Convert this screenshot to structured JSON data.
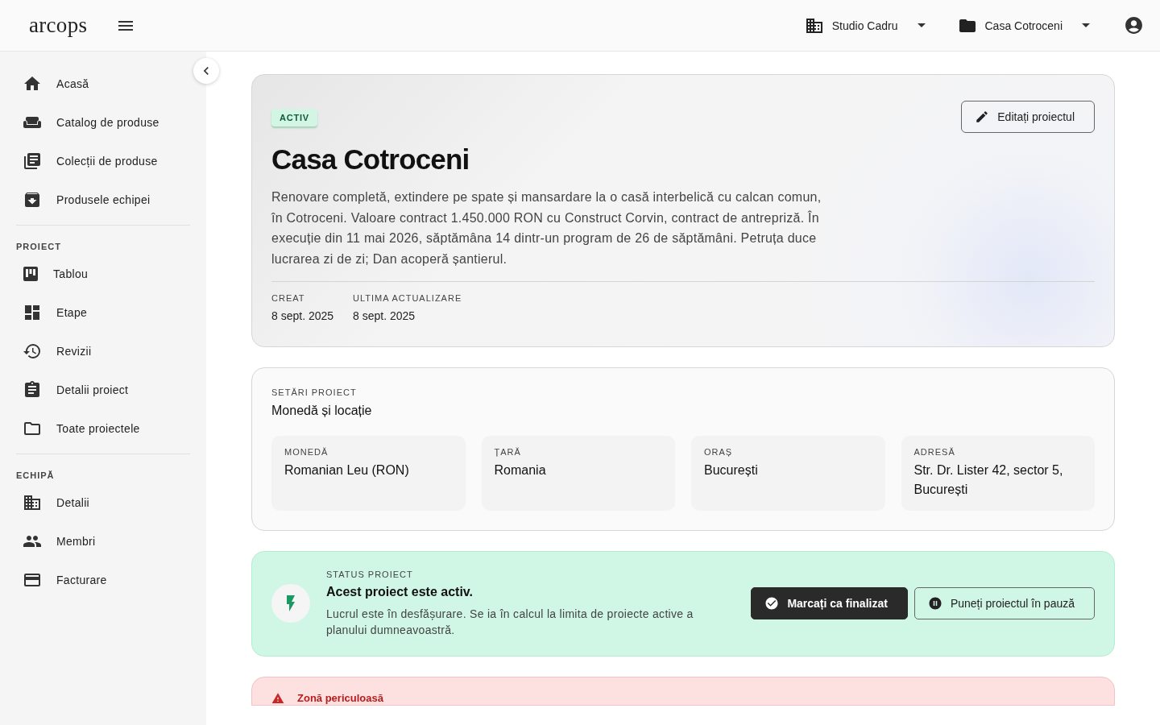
{
  "header": {
    "logo": "arcops",
    "workspace": "Studio Cadru",
    "project": "Casa Cotroceni"
  },
  "sidebar": {
    "sections": [
      {
        "items": [
          {
            "label": "Acasă"
          },
          {
            "label": "Catalog de produse"
          },
          {
            "label": "Colecții de produse"
          },
          {
            "label": "Produsele echipei"
          }
        ]
      },
      {
        "heading": "PROIECT",
        "items": [
          {
            "label": "Tablou"
          },
          {
            "label": "Etape"
          },
          {
            "label": "Revizii"
          },
          {
            "label": "Detalii proiect"
          },
          {
            "label": "Toate proiectele"
          }
        ]
      },
      {
        "heading": "ECHIPĂ",
        "items": [
          {
            "label": "Detalii"
          },
          {
            "label": "Membri"
          },
          {
            "label": "Facturare"
          }
        ]
      }
    ]
  },
  "overview": {
    "badge": "ACTIV",
    "edit_button": "Editați proiectul",
    "title": "Casa Cotroceni",
    "description": "Renovare completă, extindere pe spate și mansardare la o casă interbelică cu calcan comun, în Cotroceni. Valoare contract 1.450.000 RON cu Construct Corvin, contract de antrepriză. În execuție din 11 mai 2026, săptămâna 14 dintr-un program de 26 de săptămâni. Petruța duce lucrarea zi de zi; Dan acoperă șantierul.",
    "meta": [
      {
        "label": "CREAT",
        "value": "8 sept. 2025"
      },
      {
        "label": "ULTIMA ACTUALIZARE",
        "value": "8 sept. 2025"
      }
    ]
  },
  "settings": {
    "eyebrow": "SETĂRI PROIECT",
    "title": "Monedă și locație",
    "fields": [
      {
        "label": "MONEDĂ",
        "value": "Romanian Leu (RON)"
      },
      {
        "label": "ȚARĂ",
        "value": "Romania"
      },
      {
        "label": "ORAȘ",
        "value": "București"
      },
      {
        "label": "ADRESĂ",
        "value": "Str. Dr. Lister 42, sector 5, București"
      }
    ]
  },
  "status": {
    "eyebrow": "STATUS PROIECT",
    "title": "Acest proiect este activ.",
    "text": "Lucrul este în desfășurare. Se ia în calcul la limita de proiecte active a planului dumneavoastră.",
    "buttons": [
      {
        "label": "Marcați ca finalizat",
        "kind": "primary"
      },
      {
        "label": "Puneți proiectul în pauză",
        "kind": "outline"
      }
    ]
  },
  "danger": {
    "title": "Zonă periculoasă"
  }
}
